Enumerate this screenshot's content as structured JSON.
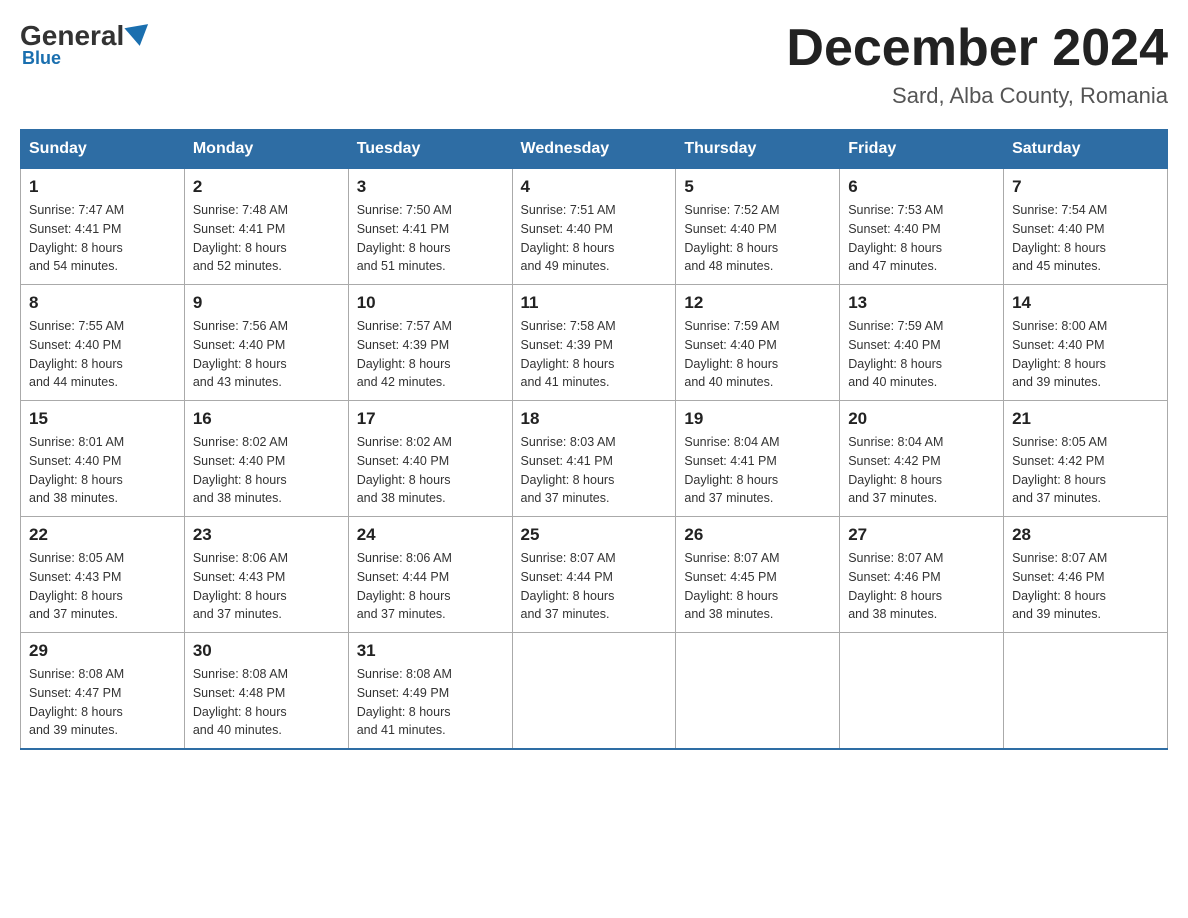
{
  "logo": {
    "general": "General",
    "blue": "Blue",
    "subtitle": "Blue"
  },
  "calendar": {
    "title": "December 2024",
    "location": "Sard, Alba County, Romania",
    "days_header": [
      "Sunday",
      "Monday",
      "Tuesday",
      "Wednesday",
      "Thursday",
      "Friday",
      "Saturday"
    ],
    "weeks": [
      [
        {
          "day": "1",
          "sunrise": "7:47 AM",
          "sunset": "4:41 PM",
          "daylight": "8 hours and 54 minutes."
        },
        {
          "day": "2",
          "sunrise": "7:48 AM",
          "sunset": "4:41 PM",
          "daylight": "8 hours and 52 minutes."
        },
        {
          "day": "3",
          "sunrise": "7:50 AM",
          "sunset": "4:41 PM",
          "daylight": "8 hours and 51 minutes."
        },
        {
          "day": "4",
          "sunrise": "7:51 AM",
          "sunset": "4:40 PM",
          "daylight": "8 hours and 49 minutes."
        },
        {
          "day": "5",
          "sunrise": "7:52 AM",
          "sunset": "4:40 PM",
          "daylight": "8 hours and 48 minutes."
        },
        {
          "day": "6",
          "sunrise": "7:53 AM",
          "sunset": "4:40 PM",
          "daylight": "8 hours and 47 minutes."
        },
        {
          "day": "7",
          "sunrise": "7:54 AM",
          "sunset": "4:40 PM",
          "daylight": "8 hours and 45 minutes."
        }
      ],
      [
        {
          "day": "8",
          "sunrise": "7:55 AM",
          "sunset": "4:40 PM",
          "daylight": "8 hours and 44 minutes."
        },
        {
          "day": "9",
          "sunrise": "7:56 AM",
          "sunset": "4:40 PM",
          "daylight": "8 hours and 43 minutes."
        },
        {
          "day": "10",
          "sunrise": "7:57 AM",
          "sunset": "4:39 PM",
          "daylight": "8 hours and 42 minutes."
        },
        {
          "day": "11",
          "sunrise": "7:58 AM",
          "sunset": "4:39 PM",
          "daylight": "8 hours and 41 minutes."
        },
        {
          "day": "12",
          "sunrise": "7:59 AM",
          "sunset": "4:40 PM",
          "daylight": "8 hours and 40 minutes."
        },
        {
          "day": "13",
          "sunrise": "7:59 AM",
          "sunset": "4:40 PM",
          "daylight": "8 hours and 40 minutes."
        },
        {
          "day": "14",
          "sunrise": "8:00 AM",
          "sunset": "4:40 PM",
          "daylight": "8 hours and 39 minutes."
        }
      ],
      [
        {
          "day": "15",
          "sunrise": "8:01 AM",
          "sunset": "4:40 PM",
          "daylight": "8 hours and 38 minutes."
        },
        {
          "day": "16",
          "sunrise": "8:02 AM",
          "sunset": "4:40 PM",
          "daylight": "8 hours and 38 minutes."
        },
        {
          "day": "17",
          "sunrise": "8:02 AM",
          "sunset": "4:40 PM",
          "daylight": "8 hours and 38 minutes."
        },
        {
          "day": "18",
          "sunrise": "8:03 AM",
          "sunset": "4:41 PM",
          "daylight": "8 hours and 37 minutes."
        },
        {
          "day": "19",
          "sunrise": "8:04 AM",
          "sunset": "4:41 PM",
          "daylight": "8 hours and 37 minutes."
        },
        {
          "day": "20",
          "sunrise": "8:04 AM",
          "sunset": "4:42 PM",
          "daylight": "8 hours and 37 minutes."
        },
        {
          "day": "21",
          "sunrise": "8:05 AM",
          "sunset": "4:42 PM",
          "daylight": "8 hours and 37 minutes."
        }
      ],
      [
        {
          "day": "22",
          "sunrise": "8:05 AM",
          "sunset": "4:43 PM",
          "daylight": "8 hours and 37 minutes."
        },
        {
          "day": "23",
          "sunrise": "8:06 AM",
          "sunset": "4:43 PM",
          "daylight": "8 hours and 37 minutes."
        },
        {
          "day": "24",
          "sunrise": "8:06 AM",
          "sunset": "4:44 PM",
          "daylight": "8 hours and 37 minutes."
        },
        {
          "day": "25",
          "sunrise": "8:07 AM",
          "sunset": "4:44 PM",
          "daylight": "8 hours and 37 minutes."
        },
        {
          "day": "26",
          "sunrise": "8:07 AM",
          "sunset": "4:45 PM",
          "daylight": "8 hours and 38 minutes."
        },
        {
          "day": "27",
          "sunrise": "8:07 AM",
          "sunset": "4:46 PM",
          "daylight": "8 hours and 38 minutes."
        },
        {
          "day": "28",
          "sunrise": "8:07 AM",
          "sunset": "4:46 PM",
          "daylight": "8 hours and 39 minutes."
        }
      ],
      [
        {
          "day": "29",
          "sunrise": "8:08 AM",
          "sunset": "4:47 PM",
          "daylight": "8 hours and 39 minutes."
        },
        {
          "day": "30",
          "sunrise": "8:08 AM",
          "sunset": "4:48 PM",
          "daylight": "8 hours and 40 minutes."
        },
        {
          "day": "31",
          "sunrise": "8:08 AM",
          "sunset": "4:49 PM",
          "daylight": "8 hours and 41 minutes."
        },
        null,
        null,
        null,
        null
      ]
    ],
    "sunrise_label": "Sunrise:",
    "sunset_label": "Sunset:",
    "daylight_label": "Daylight:"
  }
}
